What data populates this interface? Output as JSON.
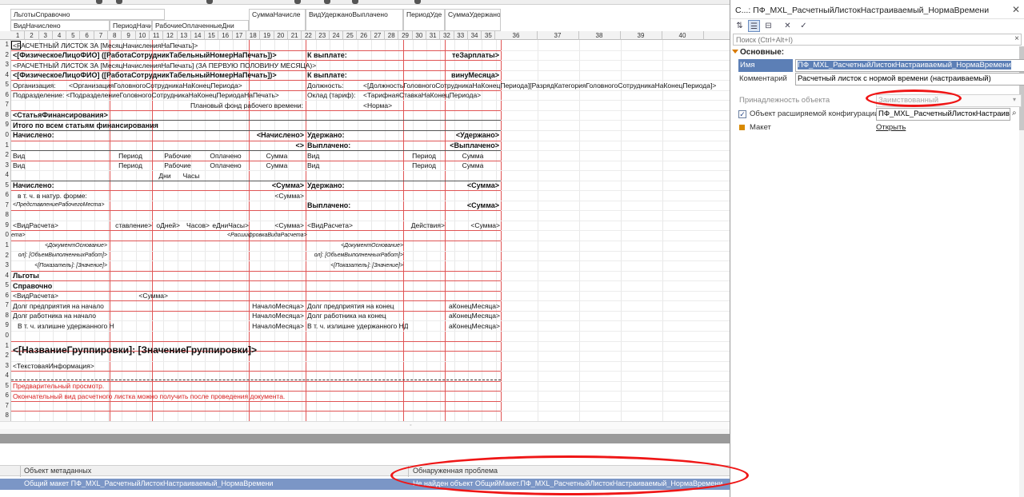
{
  "group_headers": [
    {
      "text": "ЛьготыСправочно"
    },
    {
      "text": "ВидНачислено"
    },
    {
      "text": "ПериодНачи"
    },
    {
      "text": "РабочиеОплаченныеДни"
    },
    {
      "text": "СуммаНачисле"
    },
    {
      "text": "ВидУдержаноВыплачено"
    },
    {
      "text": "ПериодУде"
    },
    {
      "text": "СуммаУдержано"
    }
  ],
  "columns": [
    "1",
    "2",
    "3",
    "4",
    "5",
    "6",
    "7",
    "8",
    "9",
    "10",
    "11",
    "12",
    "13",
    "14",
    "15",
    "16",
    "17",
    "18",
    "19",
    "20",
    "21",
    "22",
    "23",
    "24",
    "25",
    "26",
    "27",
    "28",
    "29",
    "30",
    "31",
    "32",
    "33",
    "34",
    "35",
    "36",
    "37",
    "38",
    "39",
    "40"
  ],
  "row_numbers": [
    "1",
    "2",
    "3",
    "4",
    "5",
    "6",
    "7",
    "8",
    "9",
    "0",
    "1",
    "2",
    "3",
    "4",
    "5",
    "6",
    "7",
    "8",
    "9",
    "0",
    "1",
    "2",
    "3",
    "4",
    "5",
    "6",
    "7",
    "8",
    "9",
    "0",
    "1",
    "2",
    "3",
    "4",
    "5",
    "6",
    "7",
    "8",
    "9"
  ],
  "cells": {
    "r1": "<РАСЧЕТНЫЙ ЛИСТОК ЗА [МесяцНачисленияНаПечать]>",
    "r2": "<[ФизическоеЛицоФИО] ([РаботаСотрудникТабельныйНомерНаПечать])>",
    "r2b": "К выплате:",
    "r2c": "теЗарплаты>",
    "r3": "<РАСЧЕТНЫЙ ЛИСТОК ЗА [МесяцНачисленияНаПечать] (ЗА ПЕРВУЮ ПОЛОВИНУ МЕСЯЦА)>",
    "r4": "<[ФизическоеЛицоФИО] ([РаботаСотрудникТабельныйНомерНаПечать])>",
    "r4b": "К выплате:",
    "r4c": "винуМесяца>",
    "r5a": "Организация:",
    "r5b": "<ОрганизацияГоловногоСотрудникаНаКонецПериода>",
    "r5c": "Должность:",
    "r5d": "<[ДолжностьГоловногоСотрудникаНаКонецПериода][РазрядКатегорияГоловногоСотрудникаНаКонецПериода]>",
    "r6a": "Подразделение: <ПодразделениеГоловногоСотрудникаНаКонецПериодаНаПечать>",
    "r6b": "Оклад (тариф):",
    "r6c": "<ТарифнаяСтавкаНаКонецПериода>",
    "r7a": "Плановый фонд рабочего времени:",
    "r7b": "<Норма>",
    "r8": "<СтатьяФинансирования>",
    "r9": "Итого по всем статьям финансирования",
    "r10a": "Начислено:",
    "r10b": "<Начислено>",
    "r10c": "Удержано:",
    "r10d": "<Удержано>",
    "r11a": "<>",
    "r11b": "Выплачено:",
    "r11c": "<Выплачено>",
    "h1": "Вид",
    "h2": "Период",
    "h3": "Рабочие",
    "h4": "Оплачено",
    "h5": "Сумма",
    "h6": "Вид",
    "h7": "Период",
    "h8": "Сумма",
    "h9": "Дни",
    "h10": "Часы",
    "r15a": "Начислено:",
    "r15b": "<Сумма>",
    "r15c": "Удержано:",
    "r15d": "<Сумма>",
    "r16a": "в т. ч. в натур. форме:",
    "r16b": "<Сумма>",
    "r17a": "<ПредставлениеРабочегоМеста>",
    "r17b": "Выплачено:",
    "r17c": "<Сумма>",
    "r19a": "<ВидРасчета>",
    "r19b": "ставление>",
    "r19c": "оДней>",
    "r19d": "Часов>",
    "r19e": "еДниЧасы>",
    "r19f": "<Сумма>",
    "r19g": "<ВидРасчета>",
    "r19h": "Действия>",
    "r19i": "<Сумма>",
    "r20a": "ета>",
    "r20b": "<РасшифровкаВидаРасчета>",
    "r21a": "<ДокументОснование>",
    "r21b": "<ДокументОснование>",
    "r22a": "ол]: [ОбъемВыполненныхРабот]>",
    "r22b": "ол]: [ОбъемВыполненныхРабот]>",
    "r23a": "<[Показатель]: [Значение]>",
    "r23b": "<[Показатель]: [Значение]>",
    "r24": "Льготы",
    "r25": "Справочно",
    "r26a": "<ВидРасчета>",
    "r26b": "<Сумма>",
    "r27a": "Долг предприятия на начало",
    "r27b": "НачалоМесяца>",
    "r27c": "Долг предприятия на конец",
    "r27d": "аКонецМесяца>",
    "r28a": "Долг работника на начало",
    "r28b": "НачалоМесяца>",
    "r28c": "Долг работника на конец",
    "r28d": "аКонецМесяца>",
    "r29a": "В т. ч. излишне удержанного НДФЛ",
    "r29b": "НачалоМесяца>",
    "r29c": "В т. ч. излишне удержанного НДФЛ",
    "r29d": "аКонецМесяца>",
    "r31": "<[НазваниеГруппировки]: [ЗначениеГруппировки]>",
    "r33": "<ТекстоваяИнформация>",
    "r35": "Предварительный просмотр.",
    "r36": "Окончательный вид расчетного листка можно получить после проведения документа."
  },
  "messages": {
    "col1": "Объект метаданных",
    "col2": "Обнаруженная проблема",
    "rows": [
      {
        "object": "Общий макет ПФ_MXL_РасчетныйЛистокНастраиваемый_НормаВремени",
        "problem": "Не найден объект ОбщийМакет.ПФ_MXL_РасчетныйЛистокНастраиваемый_НормаВремени"
      }
    ]
  },
  "panel": {
    "title": "С...: ПФ_MXL_РасчетныйЛистокНастраиваемый_НормаВремени",
    "search_placeholder": "Поиск (Ctrl+Alt+I)",
    "section": "Основные:",
    "name_label": "Имя",
    "name_value": "ПФ_MXL_РасчетныйЛистокНастраиваемый_НормаВремени",
    "comment_label": "Комментарий",
    "comment_value": "Расчетный листок с нормой времени (настраиваемый)",
    "ownership_label": "Принадлежность объекта",
    "ownership_value": "Заимствованный",
    "ext_label": "Объект расширяемой конфигурации",
    "ext_value": "ПФ_MXL_РасчетныйЛистокНастраива",
    "layout_label": "Макет",
    "layout_link": "Открыть"
  },
  "colors": {
    "accent_blue": "#5c7fb6",
    "message_row": "#7b96c6",
    "annotation_red": "#ef1616",
    "grid_red": "#e05555"
  }
}
